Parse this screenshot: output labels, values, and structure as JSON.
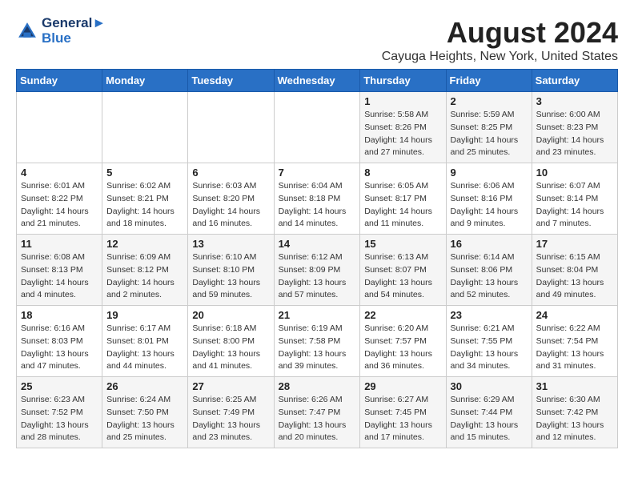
{
  "logo": {
    "line1": "General",
    "line2": "Blue"
  },
  "title": "August 2024",
  "subtitle": "Cayuga Heights, New York, United States",
  "weekdays": [
    "Sunday",
    "Monday",
    "Tuesday",
    "Wednesday",
    "Thursday",
    "Friday",
    "Saturday"
  ],
  "weeks": [
    [
      {
        "day": "",
        "info": ""
      },
      {
        "day": "",
        "info": ""
      },
      {
        "day": "",
        "info": ""
      },
      {
        "day": "",
        "info": ""
      },
      {
        "day": "1",
        "info": "Sunrise: 5:58 AM\nSunset: 8:26 PM\nDaylight: 14 hours\nand 27 minutes."
      },
      {
        "day": "2",
        "info": "Sunrise: 5:59 AM\nSunset: 8:25 PM\nDaylight: 14 hours\nand 25 minutes."
      },
      {
        "day": "3",
        "info": "Sunrise: 6:00 AM\nSunset: 8:23 PM\nDaylight: 14 hours\nand 23 minutes."
      }
    ],
    [
      {
        "day": "4",
        "info": "Sunrise: 6:01 AM\nSunset: 8:22 PM\nDaylight: 14 hours\nand 21 minutes."
      },
      {
        "day": "5",
        "info": "Sunrise: 6:02 AM\nSunset: 8:21 PM\nDaylight: 14 hours\nand 18 minutes."
      },
      {
        "day": "6",
        "info": "Sunrise: 6:03 AM\nSunset: 8:20 PM\nDaylight: 14 hours\nand 16 minutes."
      },
      {
        "day": "7",
        "info": "Sunrise: 6:04 AM\nSunset: 8:18 PM\nDaylight: 14 hours\nand 14 minutes."
      },
      {
        "day": "8",
        "info": "Sunrise: 6:05 AM\nSunset: 8:17 PM\nDaylight: 14 hours\nand 11 minutes."
      },
      {
        "day": "9",
        "info": "Sunrise: 6:06 AM\nSunset: 8:16 PM\nDaylight: 14 hours\nand 9 minutes."
      },
      {
        "day": "10",
        "info": "Sunrise: 6:07 AM\nSunset: 8:14 PM\nDaylight: 14 hours\nand 7 minutes."
      }
    ],
    [
      {
        "day": "11",
        "info": "Sunrise: 6:08 AM\nSunset: 8:13 PM\nDaylight: 14 hours\nand 4 minutes."
      },
      {
        "day": "12",
        "info": "Sunrise: 6:09 AM\nSunset: 8:12 PM\nDaylight: 14 hours\nand 2 minutes."
      },
      {
        "day": "13",
        "info": "Sunrise: 6:10 AM\nSunset: 8:10 PM\nDaylight: 13 hours\nand 59 minutes."
      },
      {
        "day": "14",
        "info": "Sunrise: 6:12 AM\nSunset: 8:09 PM\nDaylight: 13 hours\nand 57 minutes."
      },
      {
        "day": "15",
        "info": "Sunrise: 6:13 AM\nSunset: 8:07 PM\nDaylight: 13 hours\nand 54 minutes."
      },
      {
        "day": "16",
        "info": "Sunrise: 6:14 AM\nSunset: 8:06 PM\nDaylight: 13 hours\nand 52 minutes."
      },
      {
        "day": "17",
        "info": "Sunrise: 6:15 AM\nSunset: 8:04 PM\nDaylight: 13 hours\nand 49 minutes."
      }
    ],
    [
      {
        "day": "18",
        "info": "Sunrise: 6:16 AM\nSunset: 8:03 PM\nDaylight: 13 hours\nand 47 minutes."
      },
      {
        "day": "19",
        "info": "Sunrise: 6:17 AM\nSunset: 8:01 PM\nDaylight: 13 hours\nand 44 minutes."
      },
      {
        "day": "20",
        "info": "Sunrise: 6:18 AM\nSunset: 8:00 PM\nDaylight: 13 hours\nand 41 minutes."
      },
      {
        "day": "21",
        "info": "Sunrise: 6:19 AM\nSunset: 7:58 PM\nDaylight: 13 hours\nand 39 minutes."
      },
      {
        "day": "22",
        "info": "Sunrise: 6:20 AM\nSunset: 7:57 PM\nDaylight: 13 hours\nand 36 minutes."
      },
      {
        "day": "23",
        "info": "Sunrise: 6:21 AM\nSunset: 7:55 PM\nDaylight: 13 hours\nand 34 minutes."
      },
      {
        "day": "24",
        "info": "Sunrise: 6:22 AM\nSunset: 7:54 PM\nDaylight: 13 hours\nand 31 minutes."
      }
    ],
    [
      {
        "day": "25",
        "info": "Sunrise: 6:23 AM\nSunset: 7:52 PM\nDaylight: 13 hours\nand 28 minutes."
      },
      {
        "day": "26",
        "info": "Sunrise: 6:24 AM\nSunset: 7:50 PM\nDaylight: 13 hours\nand 25 minutes."
      },
      {
        "day": "27",
        "info": "Sunrise: 6:25 AM\nSunset: 7:49 PM\nDaylight: 13 hours\nand 23 minutes."
      },
      {
        "day": "28",
        "info": "Sunrise: 6:26 AM\nSunset: 7:47 PM\nDaylight: 13 hours\nand 20 minutes."
      },
      {
        "day": "29",
        "info": "Sunrise: 6:27 AM\nSunset: 7:45 PM\nDaylight: 13 hours\nand 17 minutes."
      },
      {
        "day": "30",
        "info": "Sunrise: 6:29 AM\nSunset: 7:44 PM\nDaylight: 13 hours\nand 15 minutes."
      },
      {
        "day": "31",
        "info": "Sunrise: 6:30 AM\nSunset: 7:42 PM\nDaylight: 13 hours\nand 12 minutes."
      }
    ]
  ]
}
